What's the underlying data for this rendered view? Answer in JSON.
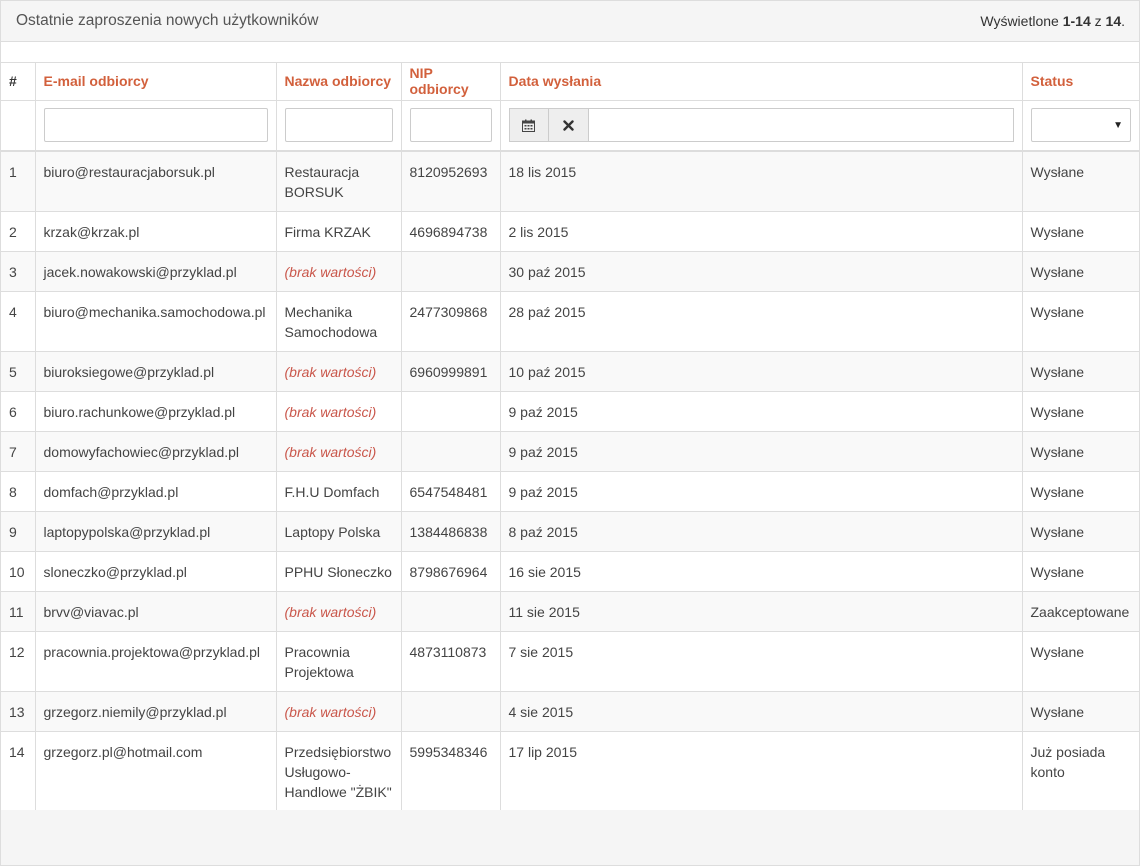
{
  "header": {
    "title": "Ostatnie zaproszenia nowych użytkowników",
    "summary_prefix": "Wyświetlone ",
    "summary_range": "1-14",
    "summary_mid": " z ",
    "summary_total": "14",
    "summary_suffix": "."
  },
  "columns": {
    "num": "#",
    "email": "E-mail odbiorcy",
    "name": "Nazwa odbiorcy",
    "nip": "NIP odbiorcy",
    "date": "Data wysłania",
    "status": "Status"
  },
  "icons": {
    "calendar": "calendar-icon",
    "clear": "close-icon",
    "dropdown": "chevron-down-icon"
  },
  "colors": {
    "header_link": "#d2603c",
    "empty_value": "#c9564a"
  },
  "rows": [
    {
      "num": "1",
      "email": "biuro@restauracjaborsuk.pl",
      "name": "Restauracja BORSUK",
      "name_empty": false,
      "nip": "8120952693",
      "date": "18 lis 2015",
      "status": "Wysłane"
    },
    {
      "num": "2",
      "email": "krzak@krzak.pl",
      "name": "Firma KRZAK",
      "name_empty": false,
      "nip": "4696894738",
      "date": "2 lis 2015",
      "status": "Wysłane"
    },
    {
      "num": "3",
      "email": "jacek.nowakowski@przyklad.pl",
      "name": "(brak wartości)",
      "name_empty": true,
      "nip": "",
      "date": "30 paź 2015",
      "status": "Wysłane"
    },
    {
      "num": "4",
      "email": "biuro@mechanika.samochodowa.pl",
      "name": "Mechanika Samochodowa",
      "name_empty": false,
      "nip": "2477309868",
      "date": "28 paź 2015",
      "status": "Wysłane"
    },
    {
      "num": "5",
      "email": "biuroksiegowe@przyklad.pl",
      "name": "(brak wartości)",
      "name_empty": true,
      "nip": "6960999891",
      "date": "10 paź 2015",
      "status": "Wysłane"
    },
    {
      "num": "6",
      "email": "biuro.rachunkowe@przyklad.pl",
      "name": "(brak wartości)",
      "name_empty": true,
      "nip": "",
      "date": "9 paź 2015",
      "status": "Wysłane"
    },
    {
      "num": "7",
      "email": "domowyfachowiec@przyklad.pl",
      "name": "(brak wartości)",
      "name_empty": true,
      "nip": "",
      "date": "9 paź 2015",
      "status": "Wysłane"
    },
    {
      "num": "8",
      "email": "domfach@przyklad.pl",
      "name": "F.H.U Domfach",
      "name_empty": false,
      "nip": "6547548481",
      "date": "9 paź 2015",
      "status": "Wysłane"
    },
    {
      "num": "9",
      "email": "laptopypolska@przyklad.pl",
      "name": "Laptopy Polska",
      "name_empty": false,
      "nip": "1384486838",
      "date": "8 paź 2015",
      "status": "Wysłane"
    },
    {
      "num": "10",
      "email": "sloneczko@przyklad.pl",
      "name": "PPHU Słoneczko",
      "name_empty": false,
      "nip": "8798676964",
      "date": "16 sie 2015",
      "status": "Wysłane"
    },
    {
      "num": "11",
      "email": "brvv@viavac.pl",
      "name": "(brak wartości)",
      "name_empty": true,
      "nip": "",
      "date": "11 sie 2015",
      "status": "Zaakceptowane"
    },
    {
      "num": "12",
      "email": "pracownia.projektowa@przyklad.pl",
      "name": "Pracownia Projektowa",
      "name_empty": false,
      "nip": "4873110873",
      "date": "7 sie 2015",
      "status": "Wysłane"
    },
    {
      "num": "13",
      "email": "grzegorz.niemily@przyklad.pl",
      "name": "(brak wartości)",
      "name_empty": true,
      "nip": "",
      "date": "4 sie 2015",
      "status": "Wysłane"
    },
    {
      "num": "14",
      "email": "grzegorz.pl@hotmail.com",
      "name": "Przedsiębiorstwo Usługowo-Handlowe \"ŻBIK\"",
      "name_empty": false,
      "nip": "5995348346",
      "date": "17 lip 2015",
      "status": "Już posiada konto"
    }
  ]
}
